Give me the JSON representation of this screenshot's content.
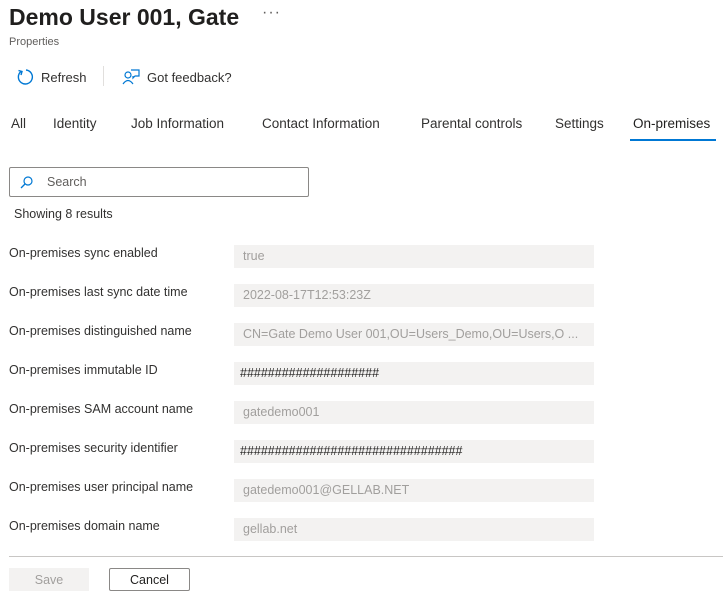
{
  "header": {
    "title": "Demo User 001, Gate",
    "subtitle": "Properties",
    "more": "···"
  },
  "toolbar": {
    "refresh": "Refresh",
    "feedback": "Got feedback?"
  },
  "tabs": [
    "All",
    "Identity",
    "Job Information",
    "Contact Information",
    "Parental controls",
    "Settings",
    "On-premises"
  ],
  "active_tab": "On-premises",
  "search": {
    "placeholder": "Search"
  },
  "results": "Showing 8 results",
  "properties": [
    {
      "label": "On-premises sync enabled",
      "value": "true"
    },
    {
      "label": "On-premises last sync date time",
      "value": "2022-08-17T12:53:23Z"
    },
    {
      "label": "On-premises distinguished name",
      "value": "CN=Gate Demo User 001,OU=Users_Demo,OU=Users,O ..."
    },
    {
      "label": "On-premises immutable ID",
      "value": "####################"
    },
    {
      "label": "On-premises SAM account name",
      "value": "gatedemo001"
    },
    {
      "label": "On-premises security identifier",
      "value": "################################"
    },
    {
      "label": "On-premises user principal name",
      "value": "gatedemo001@GELLAB.NET"
    },
    {
      "label": "On-premises domain name",
      "value": "gellab.net"
    }
  ],
  "footer": {
    "save": "Save",
    "cancel": "Cancel"
  },
  "colors": {
    "accent": "#0078d4"
  }
}
